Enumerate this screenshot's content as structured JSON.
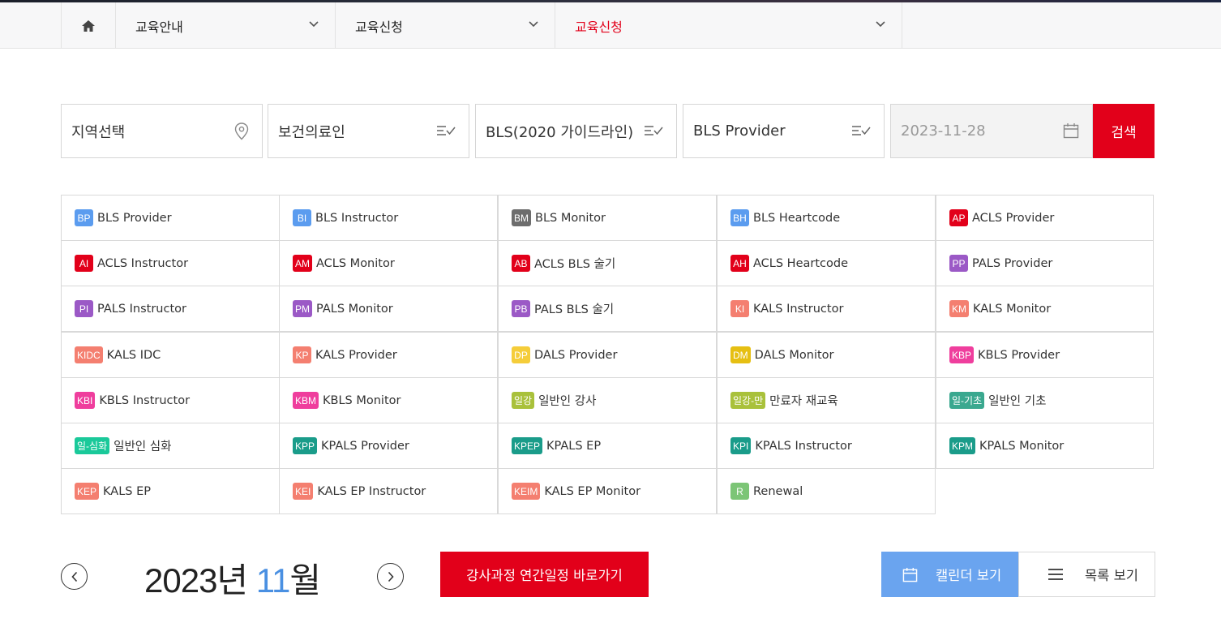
{
  "nav": {
    "crumbs": [
      {
        "label": "교육안내"
      },
      {
        "label": "교육신청"
      },
      {
        "label": "교육신청"
      }
    ]
  },
  "filters": {
    "region": "지역선택",
    "target": "보건의료인",
    "course": "BLS(2020 가이드라인)",
    "type": "BLS Provider",
    "date": "2023-11-28",
    "search": "검색"
  },
  "courses": [
    {
      "code": "BP",
      "name": "BLS Provider",
      "color": "#5b9cef"
    },
    {
      "code": "BI",
      "name": "BLS Instructor",
      "color": "#5b9cef"
    },
    {
      "code": "BM",
      "name": "BLS Monitor",
      "color": "#6d6d6d"
    },
    {
      "code": "BH",
      "name": "BLS Heartcode",
      "color": "#5b9cef"
    },
    {
      "code": "AP",
      "name": "ACLS Provider",
      "color": "#e2001a"
    },
    {
      "code": "AI",
      "name": "ACLS Instructor",
      "color": "#e2001a"
    },
    {
      "code": "AM",
      "name": "ACLS Monitor",
      "color": "#e2001a"
    },
    {
      "code": "AB",
      "name": "ACLS BLS 술기",
      "color": "#e2001a"
    },
    {
      "code": "AH",
      "name": "ACLS Heartcode",
      "color": "#e2001a"
    },
    {
      "code": "PP",
      "name": "PALS Provider",
      "color": "#9b59c6"
    },
    {
      "code": "PI",
      "name": "PALS Instructor",
      "color": "#9b59c6"
    },
    {
      "code": "PM",
      "name": "PALS Monitor",
      "color": "#9b59c6"
    },
    {
      "code": "PB",
      "name": "PALS BLS 술기",
      "color": "#9b59c6"
    },
    {
      "code": "KI",
      "name": "KALS Instructor",
      "color": "#f47f70"
    },
    {
      "code": "KM",
      "name": "KALS Monitor",
      "color": "#f47f70"
    },
    {
      "code": "KIDC",
      "name": "KALS IDC",
      "color": "#f47f70"
    },
    {
      "code": "KP",
      "name": "KALS Provider",
      "color": "#f47f70"
    },
    {
      "code": "DP",
      "name": "DALS Provider",
      "color": "#f5cd3a"
    },
    {
      "code": "DM",
      "name": "DALS Monitor",
      "color": "#e6bf12"
    },
    {
      "code": "KBP",
      "name": "KBLS Provider",
      "color": "#ef3e9d"
    },
    {
      "code": "KBI",
      "name": "KBLS Instructor",
      "color": "#ef3e9d"
    },
    {
      "code": "KBM",
      "name": "KBLS Monitor",
      "color": "#ef3e9d"
    },
    {
      "code": "일강",
      "name": "일반인 강사",
      "color": "#a9c13b"
    },
    {
      "code": "일강-만",
      "name": "만료자 재교육",
      "color": "#a9c13b"
    },
    {
      "code": "일-기초",
      "name": "일반인 기초",
      "color": "#3aa88f"
    },
    {
      "code": "일-심화",
      "name": "일반인 심화",
      "color": "#1ac99a"
    },
    {
      "code": "KPP",
      "name": "KPALS Provider",
      "color": "#1a9c8a"
    },
    {
      "code": "KPEP",
      "name": "KPALS EP",
      "color": "#1a9c8a"
    },
    {
      "code": "KPI",
      "name": "KPALS Instructor",
      "color": "#1a9c8a"
    },
    {
      "code": "KPM",
      "name": "KPALS Monitor",
      "color": "#1a9c8a"
    },
    {
      "code": "KEP",
      "name": "KALS EP",
      "color": "#f47f70"
    },
    {
      "code": "KEI",
      "name": "KALS EP Instructor",
      "color": "#f47f70"
    },
    {
      "code": "KEIM",
      "name": "KALS EP Monitor",
      "color": "#f47f70"
    },
    {
      "code": "R",
      "name": "Renewal",
      "color": "#7cc576"
    }
  ],
  "calendar": {
    "year_label": "2023년 ",
    "month_num": "11",
    "month_suffix": "월",
    "annual_button": "강사과정 연간일정 바로가기",
    "view_calendar": "캘린더 보기",
    "view_list": "목록 보기"
  }
}
